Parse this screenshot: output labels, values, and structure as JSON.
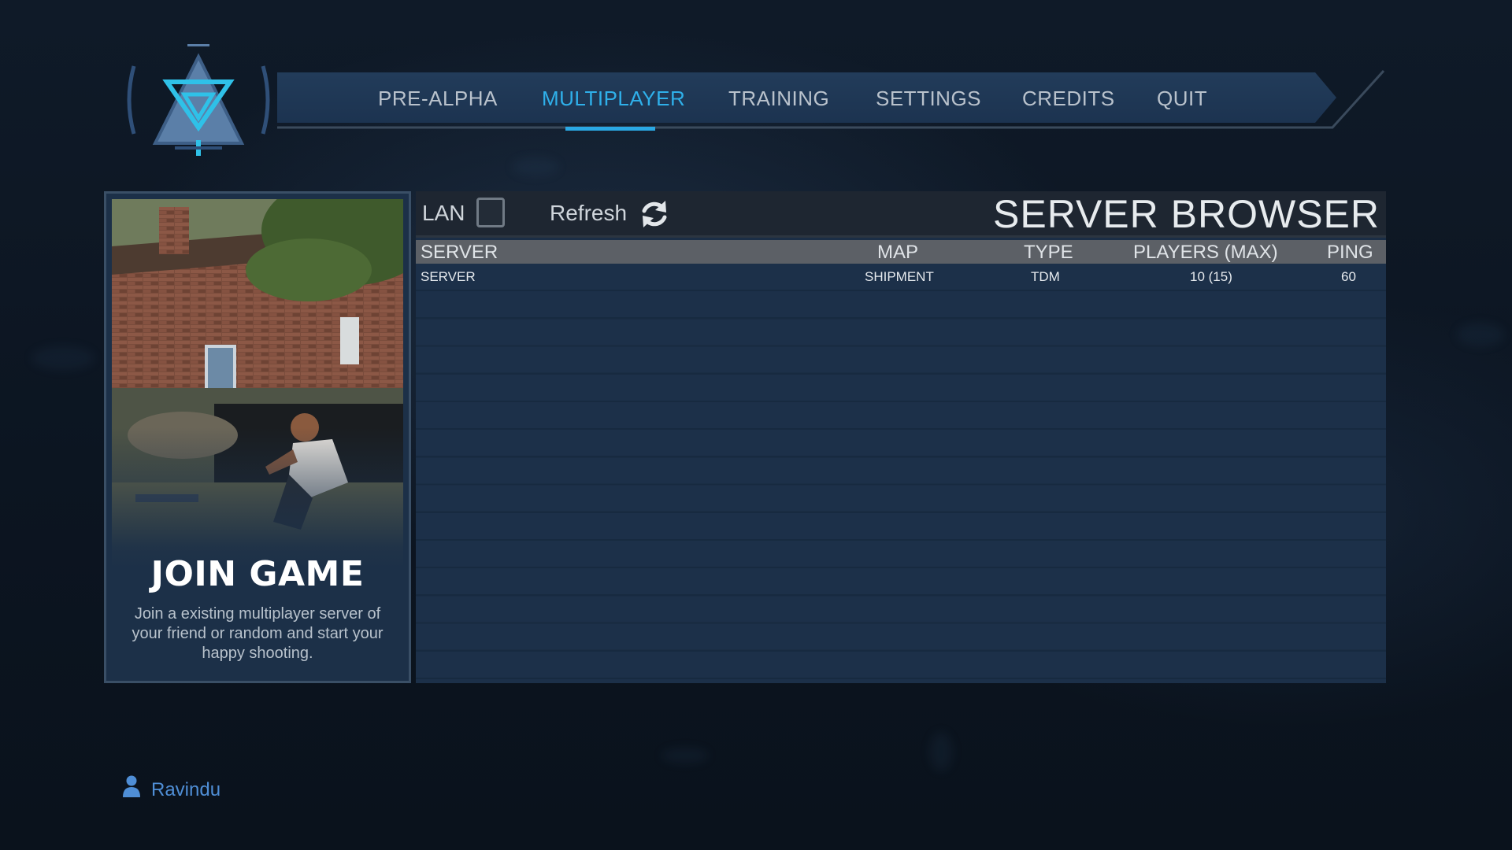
{
  "nav": {
    "items": [
      {
        "label": "PRE-ALPHA",
        "active": false
      },
      {
        "label": "MULTIPLAYER",
        "active": true
      },
      {
        "label": "TRAINING",
        "active": false
      },
      {
        "label": "SETTINGS",
        "active": false
      },
      {
        "label": "CREDITS",
        "active": false
      },
      {
        "label": "QUIT",
        "active": false
      }
    ],
    "active_color": "#2fb0ea"
  },
  "join_card": {
    "title": "JOIN GAME",
    "description": "Join a existing multiplayer server of your friend or random and start your happy shooting."
  },
  "browser": {
    "title": "SERVER BROWSER",
    "lan_label": "LAN",
    "lan_checked": false,
    "refresh_label": "Refresh",
    "columns": [
      "SERVER",
      "MAP",
      "TYPE",
      "PLAYERS (MAX)",
      "PING"
    ],
    "rows": [
      {
        "server": "SERVER",
        "map": "SHIPMENT",
        "type": "TDM",
        "players": "10 (15)",
        "ping": "60"
      }
    ]
  },
  "user": {
    "name": "Ravindu",
    "icon": "user-icon",
    "color": "#4f8ed6"
  }
}
